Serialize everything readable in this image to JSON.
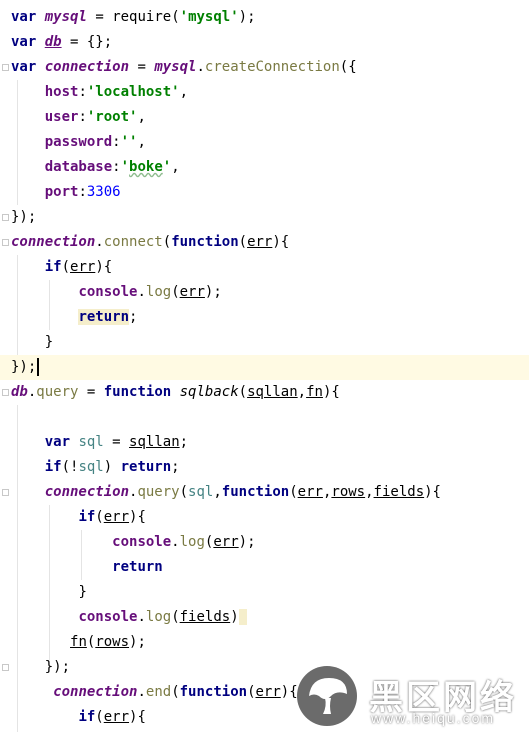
{
  "code": {
    "l1": {
      "kw": "var",
      "name": "mysql",
      "eq": " = ",
      "fn": "require",
      "open": "(",
      "str": "'mysql'",
      "close": ");"
    },
    "l2": {
      "kw": "var",
      "name": "db",
      "rest": " = {};"
    },
    "l3": {
      "kw": "var",
      "name": "connection",
      "eq": " = ",
      "obj": "mysql",
      "dot": ".",
      "fn": "createConnection",
      "rest": "({"
    },
    "l4": {
      "key": "host",
      "colon": ":",
      "str": "'localhost'",
      "comma": ","
    },
    "l5": {
      "key": "user",
      "colon": ":",
      "str": "'root'",
      "comma": ","
    },
    "l6": {
      "key": "password",
      "colon": ":",
      "str": "''",
      "comma": ","
    },
    "l7": {
      "key": "database",
      "colon": ":",
      "q1": "'",
      "str": "boke",
      "q2": "'",
      "comma": ","
    },
    "l8": {
      "key": "port",
      "colon": ":",
      "num": "3306"
    },
    "l9": {
      "text": "});"
    },
    "l10": {
      "obj": "connection",
      "dot": ".",
      "fn": "connect",
      "open": "(",
      "kw": "function",
      "p1": "(",
      "arg": "err",
      "rest": "){"
    },
    "l11": {
      "kw": "if",
      "open": "(",
      "arg": "err",
      "rest": "){"
    },
    "l12": {
      "obj": "console",
      "dot": ".",
      "fn": "log",
      "open": "(",
      "arg": "err",
      "rest": ");"
    },
    "l13": {
      "kw": "return",
      "rest": ";"
    },
    "l14": {
      "text": "}"
    },
    "l15": {
      "text": "});"
    },
    "l16": {
      "obj": "db",
      "dot": ".",
      "fn": "query",
      "eq": " = ",
      "kw": "function",
      "name": "sqlback",
      "open": "(",
      "a1": "sqllan",
      "comma": ",",
      "a2": "fn",
      "rest": "){"
    },
    "l18": {
      "kw": "var",
      "sp": " ",
      "name": "sql",
      "eq": " = ",
      "arg": "sqllan",
      "rest": ";"
    },
    "l19": {
      "kw": "if",
      "open": "(!",
      "name": "sql",
      "close": ") ",
      "kw2": "return",
      "rest": ";"
    },
    "l20": {
      "obj": "connection",
      "dot": ".",
      "fn": "query",
      "open": "(",
      "a0": "sql",
      "c0": ",",
      "kw": "function",
      "p1": "(",
      "a1": "err",
      "c1": ",",
      "a2": "rows",
      "c2": ",",
      "a3": "fields",
      "rest": "){"
    },
    "l21": {
      "kw": "if",
      "open": "(",
      "arg": "err",
      "rest": "){"
    },
    "l22": {
      "obj": "console",
      "dot": ".",
      "fn": "log",
      "open": "(",
      "arg": "err",
      "rest": ");"
    },
    "l23": {
      "kw": "return"
    },
    "l24": {
      "text": "}"
    },
    "l25": {
      "obj": "console",
      "dot": ".",
      "fn": "log",
      "open": "(",
      "arg": "fields",
      "close": ")"
    },
    "l26": {
      "fn": "fn",
      "open": "(",
      "arg": "rows",
      "rest": ");"
    },
    "l27": {
      "text": "});"
    },
    "l28": {
      "obj": "connection",
      "dot": ".",
      "fn": "end",
      "open": "(",
      "kw": "function",
      "p1": "(",
      "arg": "err",
      "rest": "){"
    },
    "l29": {
      "kw": "if",
      "open": "(",
      "arg": "err",
      "rest": "){"
    }
  },
  "watermark": {
    "name": "黑区网络",
    "url": "www.heiqu.com"
  },
  "colors": {
    "keyword": "#000080",
    "global_var": "#660e7a",
    "string": "#008000",
    "number": "#0000ff",
    "method_call": "#7a7a43",
    "local_var": "#458383",
    "caret_row": "#fffae3"
  }
}
